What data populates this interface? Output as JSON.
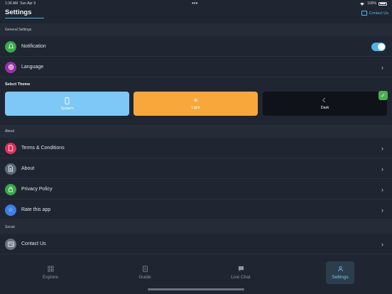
{
  "status_bar": {
    "time": "1:36 AM",
    "date": "Sun Apr 9",
    "dots": "•••",
    "battery": "100%"
  },
  "header": {
    "title": "Settings",
    "contact_label": "Contact Us"
  },
  "general": {
    "section_label": "General Settings",
    "notification_label": "Notification",
    "notification_on": true,
    "language_label": "Language"
  },
  "theme": {
    "title": "Select Theme",
    "options": [
      {
        "label": "System",
        "icon": "phone-icon",
        "color": "#7ec8f7",
        "selected": false
      },
      {
        "label": "Light",
        "icon": "sun-icon",
        "color": "#f8a73b",
        "selected": false
      },
      {
        "label": "Dark",
        "icon": "moon-icon",
        "color": "#0f1319",
        "selected": true
      }
    ]
  },
  "about": {
    "section_label": "About",
    "items": [
      {
        "label": "Terms & Conditions",
        "icon": "document-icon",
        "color": "#e0315e"
      },
      {
        "label": "About",
        "icon": "info-document-icon",
        "color": "#5e6b78"
      },
      {
        "label": "Privacy Policy",
        "icon": "lock-icon",
        "color": "#3aa84a"
      },
      {
        "label": "Rate this app",
        "icon": "star-icon",
        "color": "#3d7ee6"
      }
    ]
  },
  "social": {
    "section_label": "Social",
    "items": [
      {
        "label": "Contact Us",
        "icon": "contact-card-icon",
        "color": "#6b7480"
      }
    ]
  },
  "nav": {
    "items": [
      {
        "label": "Explore",
        "icon": "grid-icon",
        "active": false
      },
      {
        "label": "Guide",
        "icon": "book-icon",
        "active": false
      },
      {
        "label": "Live Chat",
        "icon": "chat-icon",
        "active": false
      },
      {
        "label": "Settings",
        "icon": "person-icon",
        "active": true
      }
    ]
  },
  "colors": {
    "background": "#1f2631",
    "accent": "#4fb3e8",
    "check": "#4caf50"
  }
}
